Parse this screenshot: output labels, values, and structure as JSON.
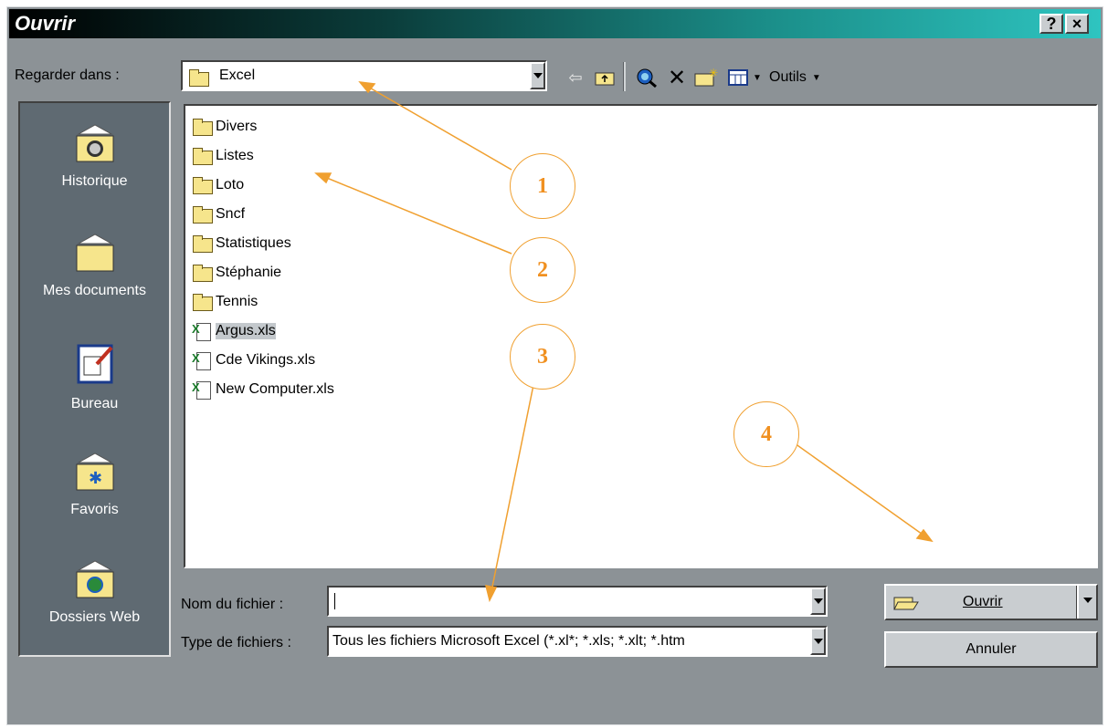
{
  "window": {
    "title": "Ouvrir",
    "help_button": "?",
    "close_button": "×"
  },
  "lookin": {
    "label": "Regarder dans :",
    "value": "Excel"
  },
  "toolbar": {
    "tools_label": "Outils"
  },
  "places": [
    {
      "label": "Historique",
      "icon": "history-folder-icon"
    },
    {
      "label": "Mes documents",
      "icon": "my-documents-folder-icon"
    },
    {
      "label": "Bureau",
      "icon": "desktop-icon"
    },
    {
      "label": "Favoris",
      "icon": "favorites-folder-icon"
    },
    {
      "label": "Dossiers Web",
      "icon": "web-folders-icon"
    }
  ],
  "files": [
    {
      "name": "Divers",
      "type": "folder"
    },
    {
      "name": "Listes",
      "type": "folder"
    },
    {
      "name": "Loto",
      "type": "folder"
    },
    {
      "name": "Sncf",
      "type": "folder"
    },
    {
      "name": "Statistiques",
      "type": "folder"
    },
    {
      "name": "Stéphanie",
      "type": "folder"
    },
    {
      "name": "Tennis",
      "type": "folder"
    },
    {
      "name": "Argus.xls",
      "type": "excel",
      "selected": true
    },
    {
      "name": "Cde Vikings.xls",
      "type": "excel"
    },
    {
      "name": "New Computer.xls",
      "type": "excel"
    }
  ],
  "filename": {
    "label": "Nom du fichier :",
    "value": ""
  },
  "filetype": {
    "label": "Type de fichiers :",
    "value": "Tous les fichiers Microsoft Excel (*.xl*; *.xls; *.xlt; *.htm"
  },
  "buttons": {
    "open": "Ouvrir",
    "cancel": "Annuler"
  },
  "annotations": [
    "1",
    "2",
    "3",
    "4"
  ],
  "colors": {
    "annotation": "#f0a030",
    "titlebar_end": "#2ec4c0"
  }
}
